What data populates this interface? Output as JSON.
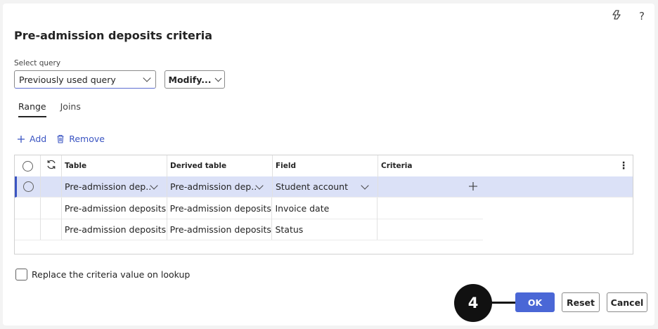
{
  "dialog": {
    "title": "Pre-admission deposits criteria",
    "icons": {
      "copilot": "copilot-icon",
      "help": "?"
    }
  },
  "query": {
    "label": "Select query",
    "selected": "Previously used query",
    "modify_label": "Modify..."
  },
  "tabs": [
    {
      "label": "Range",
      "active": true
    },
    {
      "label": "Joins",
      "active": false
    }
  ],
  "actions": {
    "add_label": "Add",
    "remove_label": "Remove"
  },
  "grid": {
    "columns": [
      "Table",
      "Derived table",
      "Field",
      "Criteria"
    ],
    "rows": [
      {
        "table": "Pre-admission dep...",
        "derived": "Pre-admission dep...",
        "field": "Student account",
        "criteria": "",
        "selected": true
      },
      {
        "table": "Pre-admission deposits",
        "derived": "Pre-admission deposits",
        "field": "Invoice date",
        "criteria": "",
        "selected": false
      },
      {
        "table": "Pre-admission deposits",
        "derived": "Pre-admission deposits",
        "field": "Status",
        "criteria": "",
        "selected": false
      }
    ]
  },
  "options": {
    "replace_criteria_label": "Replace the criteria value on lookup",
    "replace_criteria_checked": false
  },
  "step": {
    "number": "4"
  },
  "buttons": {
    "ok": "OK",
    "reset": "Reset",
    "cancel": "Cancel"
  },
  "colors": {
    "accent": "#4a67d6",
    "selected_row": "#dbe1f7",
    "link": "#3a54c2"
  }
}
